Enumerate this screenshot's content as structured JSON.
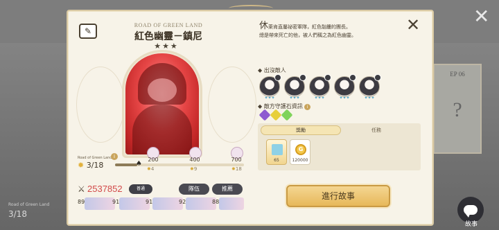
{
  "background": {
    "ep_label": "EP 06",
    "ep_question": "?",
    "area_label": "Road of Green Land",
    "progress": "3/18",
    "close_glyph": "✕",
    "story_label": "故事"
  },
  "stage": {
    "subtitle": "ROAD OF GREEN LAND",
    "title": "紅色幽靈－鎮尼",
    "difficulty_stars": "★★★",
    "area_label": "Road of Green Land",
    "progress": "3/18",
    "progress_fraction": 0.17,
    "rewards": [
      {
        "value": "200",
        "milestone": "4"
      },
      {
        "value": "400",
        "milestone": "9"
      },
      {
        "value": "700",
        "milestone": "18"
      }
    ],
    "power": "2537852",
    "mode_label": "普通",
    "team_button": "隊伍",
    "recommend_button": "推薦",
    "team_levels": [
      "89",
      "91",
      "91",
      "92",
      "88"
    ]
  },
  "details": {
    "description_first_char": "休",
    "description_rest": "萊肯直屬祕密軍隊，紅色骷髏的團長。",
    "description_line2": "總是帶來死亡的他，被人們稱之為紅色幽靈。",
    "enemies_label": "出沒敵人",
    "enemies_count": 5,
    "stones_label": "敵方守護石資訊",
    "tabs": {
      "reward": "獎勵",
      "mission": "任務"
    },
    "items": [
      {
        "icon": "gift-box-icon",
        "count": "65"
      },
      {
        "icon": "gold-coin-icon",
        "label": "G",
        "count": "120000"
      }
    ],
    "start_button": "進行故事"
  },
  "colors": {
    "power": "#d24949",
    "accent_gold": "#e7b85a",
    "portrait_red": "#e64646"
  }
}
